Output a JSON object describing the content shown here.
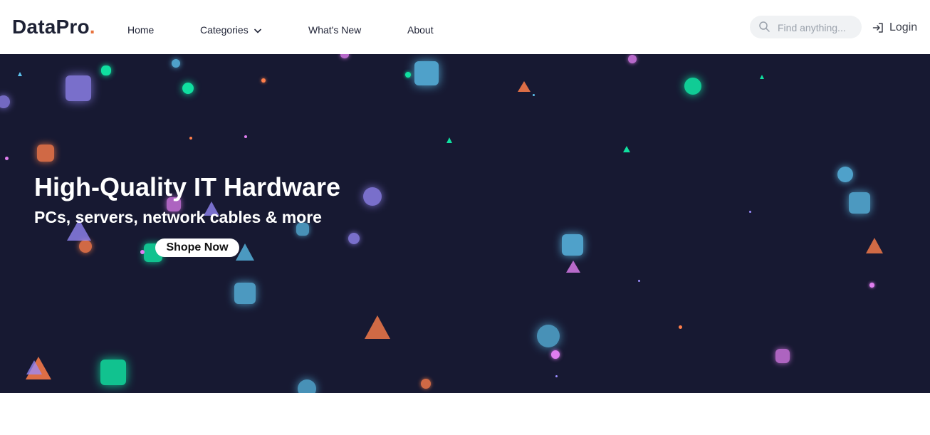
{
  "brand": {
    "name": "DataPro",
    "dot": ".",
    "accent": "#e8733f",
    "text_color": "#1e2235"
  },
  "nav": {
    "items": [
      "Home",
      "Categories",
      "What's New",
      "About"
    ],
    "categories_icon": "chevron-down-icon"
  },
  "search": {
    "placeholder": "Find anything...",
    "icon": "search-icon"
  },
  "login": {
    "label": "Login",
    "icon": "login-icon"
  },
  "hero": {
    "title": "High-Quality IT Hardware",
    "subtitle": "PCs, servers, network cables & more",
    "cta_label": "Shope Now",
    "background": "#171932",
    "particle_colors": [
      "#5ec4f0",
      "#10e0a0",
      "#ff7e4a",
      "#9a8cff",
      "#e07ef0"
    ]
  }
}
